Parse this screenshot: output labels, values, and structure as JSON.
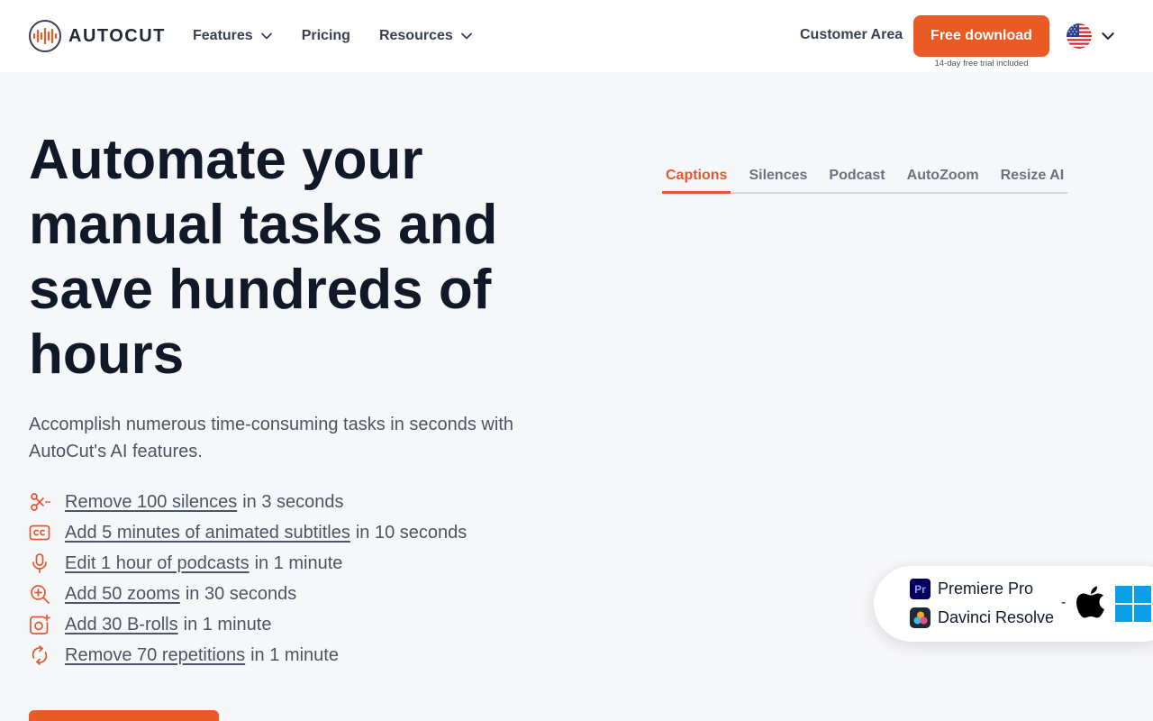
{
  "brand": {
    "name": "AUTOCUT",
    "accent_color": "#ea5a24"
  },
  "nav": {
    "items": [
      {
        "label": "Features",
        "has_dropdown": true
      },
      {
        "label": "Pricing",
        "has_dropdown": false
      },
      {
        "label": "Resources",
        "has_dropdown": true
      }
    ],
    "customer_area": "Customer Area",
    "cta_label": "Free download",
    "cta_note": "14-day free trial included",
    "language_icon": "us-flag-icon"
  },
  "hero": {
    "title": "Automate your manual tasks and save hundreds of hours",
    "subtitle": "Accomplish numerous time-consuming tasks in seconds with AutoCut's AI features.",
    "features": [
      {
        "icon": "scissors-icon",
        "link": "Remove 100 silences",
        "rest": "in 3 seconds"
      },
      {
        "icon": "closed-captions-icon",
        "link": "Add 5 minutes of animated subtitles",
        "rest": "in 10 seconds"
      },
      {
        "icon": "microphone-icon",
        "link": "Edit 1 hour of podcasts",
        "rest": "in 1 minute"
      },
      {
        "icon": "zoom-in-icon",
        "link": "Add 50 zooms",
        "rest": "in 30 seconds"
      },
      {
        "icon": "image-add-icon",
        "link": "Add 30 B-rolls",
        "rest": "in 1 minute"
      },
      {
        "icon": "repeat-icon",
        "link": "Remove 70 repetitions",
        "rest": "in 1 minute"
      }
    ]
  },
  "tabs": {
    "items": [
      "Captions",
      "Silences",
      "Podcast",
      "AutoZoom",
      "Resize AI"
    ],
    "active": "Captions"
  },
  "compatibility": {
    "apps": [
      {
        "name": "Premiere Pro",
        "icon": "premiere-pro-icon",
        "badge": "Pr"
      },
      {
        "name": "Davinci Resolve",
        "icon": "davinci-resolve-icon"
      }
    ],
    "separator": "-",
    "os": [
      "apple-icon",
      "windows-icon"
    ]
  }
}
